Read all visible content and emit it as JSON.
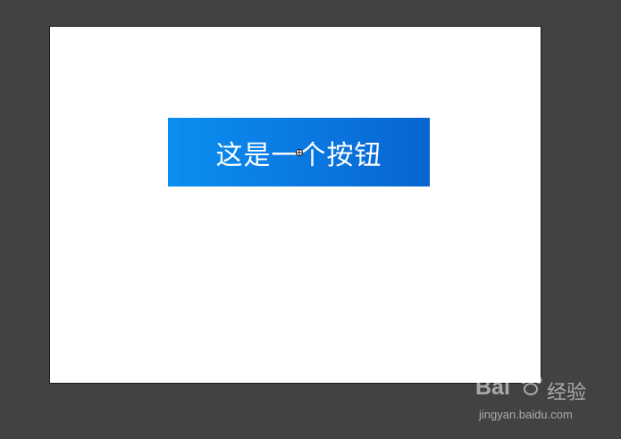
{
  "canvas": {
    "background_color": "#424242",
    "artboard_color": "#ffffff"
  },
  "button": {
    "label": "这是一个按钮",
    "gradient_start": "#0a8ff0",
    "gradient_end": "#0665cf",
    "text_color": "#ffffff"
  },
  "cursor": {
    "icon": "crosshair-anchor-icon"
  },
  "watermark": {
    "brand": "Bai  ",
    "logo_icon": "paw-icon",
    "cn_text": "经验",
    "url": "jingyan.baidu.com"
  }
}
